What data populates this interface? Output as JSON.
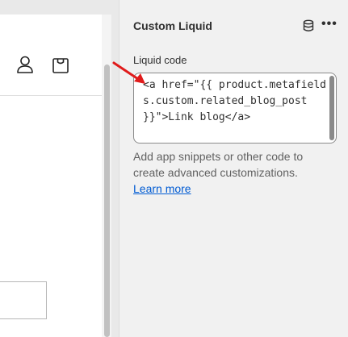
{
  "panel": {
    "title": "Custom Liquid",
    "db_icon": "database-icon",
    "more_icon": "more-horizontal-icon",
    "more_glyph": "•••"
  },
  "field": {
    "label": "Liquid code",
    "value": "<a href=\"{{ product.metafields.custom.related_blog_post }}\">Link blog</a>"
  },
  "help": {
    "text": "Add app snippets or other code to create advanced customizations.",
    "link": "Learn more"
  },
  "preview": {
    "account_icon": "account-icon",
    "cart_icon": "shopping-bag-icon"
  },
  "colors": {
    "link": "#005bd3",
    "arrow": "#e01b1b"
  }
}
